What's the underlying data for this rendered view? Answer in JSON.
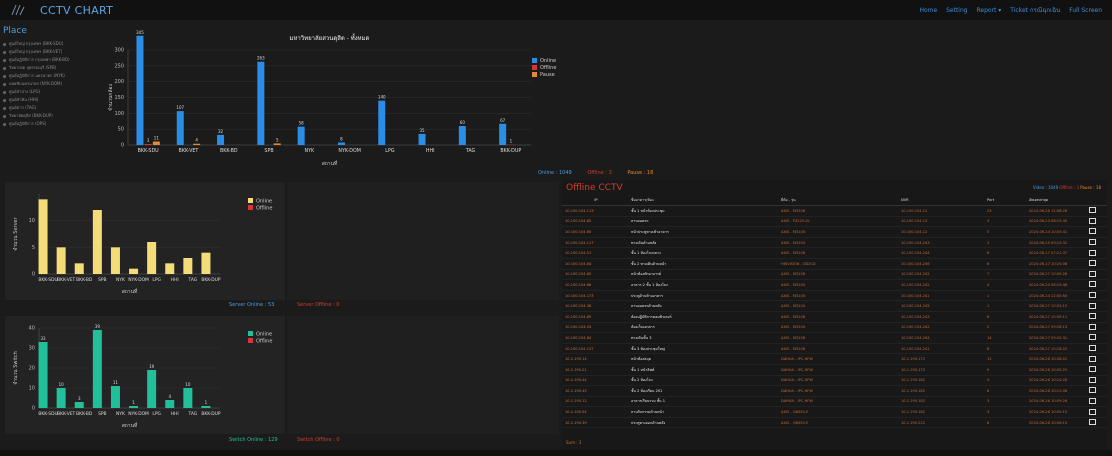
{
  "app": {
    "title": "CCTV CHART"
  },
  "nav": [
    "Home",
    "Setting",
    "Report",
    "Ticket กรณีฉุกเฉิน",
    "Full Screen"
  ],
  "place": {
    "title": "Place",
    "items": [
      "ศูนย์ใหญ่ กรุงเทพฯ (BKK-SDU)",
      "ศูนย์ใหญ่ กรุงเทพฯ (BKK-VET)",
      "ศูนย์ปฏิบัติการ กรุงเทพฯ (BKK-BD)",
      "วิทยาเขต สุพรรณบุรี (SPB)",
      "ศูนย์ปฏิบัติการ นครนายก (NYK)",
      "ดอยซับนครนายก (NYK-DOM)",
      "ศูนย์ลำปาง (LPG)",
      "ศูนย์หัวหิน (HHI)",
      "ศูนย์ตาก (TAG)",
      "วิทยาลัยดุสิต (BKK-DUP)",
      "ศูนย์ปฏิบัติการ (OPS)"
    ]
  },
  "colors": {
    "online": "#2b8ee6",
    "offline": "#d8323a",
    "pause": "#e58a2b",
    "yellow": "#f4dc78",
    "teal": "#22c09a"
  },
  "main_chart": {
    "type": "bar",
    "title": "มหาวิทยาลัยสวนดุสิต - ทั้งหมด",
    "ylabel": "จำนวนกล้อง",
    "xlabel": "สถานที่",
    "ylim": [
      0,
      300
    ],
    "yticks": [
      0,
      50,
      100,
      150,
      200,
      250,
      300
    ],
    "categories": [
      "BKK-SDU",
      "BKK-VET",
      "BKK-BD",
      "SPB",
      "NYK",
      "NYK-DOM",
      "LPG",
      "HHI",
      "TAG",
      "BKK-DUP"
    ],
    "series": [
      {
        "name": "Online",
        "values": [
          345,
          107,
          32,
          263,
          58,
          8,
          140,
          35,
          60,
          67
        ]
      },
      {
        "name": "Offline",
        "values": [
          3,
          0,
          0,
          0,
          0,
          0,
          0,
          0,
          0,
          1
        ]
      },
      {
        "name": "Pause",
        "values": [
          11,
          4,
          0,
          5,
          0,
          0,
          0,
          0,
          0,
          0
        ]
      }
    ],
    "legend": [
      "Online",
      "Offline",
      "Pause"
    ]
  },
  "stats": {
    "online": "Online : 1049",
    "offline": "Offline : 3",
    "pause": "Pause : 18"
  },
  "server_chart": {
    "type": "bar",
    "ylabel": "จำนวน Server",
    "xlabel": "สถานที่",
    "ylim": [
      0,
      15
    ],
    "yticks": [
      0,
      5,
      10
    ],
    "categories": [
      "BKK-SDU",
      "BKK-VET",
      "BKK-BD",
      "SPB",
      "NYK",
      "NYK-DOM",
      "LPG",
      "HHI",
      "TAG",
      "BKK-DUP"
    ],
    "series": [
      {
        "name": "Online",
        "values": [
          14,
          5,
          2,
          12,
          5,
          1,
          6,
          2,
          3,
          4
        ]
      },
      {
        "name": "Offline",
        "values": [
          0,
          0,
          0,
          0,
          0,
          0,
          0,
          0,
          0,
          0
        ]
      }
    ],
    "legend": [
      "Online",
      "Offline"
    ],
    "footer_online": "Server Online : 53",
    "footer_offline": "Server Offline : 0"
  },
  "switch_chart": {
    "type": "bar",
    "ylabel": "จำนวน Switch",
    "xlabel": "สถานที่",
    "ylim": [
      0,
      40
    ],
    "yticks": [
      0,
      10,
      20,
      30,
      40
    ],
    "categories": [
      "BKK-SDU",
      "BKK-VET",
      "BKK-BD",
      "SPB",
      "NYK",
      "NYK-DOM",
      "LPG",
      "HHI",
      "TAG",
      "BKK-DUP"
    ],
    "series": [
      {
        "name": "Online",
        "values": [
          33,
          10,
          3,
          39,
          11,
          1,
          19,
          4,
          10,
          1
        ]
      },
      {
        "name": "Offline",
        "values": [
          0,
          0,
          0,
          0,
          0,
          0,
          0,
          0,
          0,
          0
        ]
      }
    ],
    "legend": [
      "Online",
      "Offline"
    ],
    "footer_online": "Switch Online : 129",
    "footer_offline": "Switch Offline : 0"
  },
  "offline_cctv": {
    "title": "Offline CCTV",
    "stats": {
      "video": "Video : 1049",
      "offline": "Offline : 3",
      "pause": "Pause : 18"
    },
    "headers": [
      "IP",
      "ชื่ออาคาร/ห้อง",
      "ยี่ห้อ - รุ่น",
      "NVR",
      "Port",
      "อัพเดทล่าสุด",
      ""
    ],
    "rows": [
      [
        "10.100.104.113",
        "ชั้น 1 หน้าห้องประชุม",
        "AXIS - M3106",
        "10.100.104.12",
        "23",
        "2024-06-26 12:08:28"
      ],
      [
        "10.100.104.62",
        "ลานจอดรถ",
        "AXIS - P3225-LV",
        "10.100.104.13",
        "3",
        "2024-06-23 08:25:40"
      ],
      [
        "10.100.104.60",
        "หน้าประตูทางเข้าอาคาร",
        "AXIS - M3104",
        "10.100.104.12",
        "5",
        "2024-06-24 10:05:41"
      ],
      [
        "10.100.104.117",
        "ทางเดินด้านหลัง",
        "AXIS - M3104",
        "10.100.104.243",
        "3",
        "2024-06-25 09:15:32"
      ],
      [
        "10.100.104.51",
        "ชั้น 1 ห้องโถงกลาง",
        "AXIS - M3106",
        "10.100.104.244",
        "6",
        "2024-06-17 07:21:37"
      ],
      [
        "10.100.104.64",
        "ชั้น 2 ทางเดินด้านหน้า",
        "HIKVISION - DS2CD",
        "10.100.104.246",
        "6",
        "2024-06-17 10:25:08"
      ],
      [
        "10.100.104.65",
        "หน้าห้องพักอาจารย์",
        "AXIS - M3106",
        "10.100.104.242",
        "7",
        "2024-06-27 10:09:28"
      ],
      [
        "10.100.104.66",
        "อาคาร 2 ชั้น 1 ห้องโถง",
        "AXIS - M3104",
        "10.100.104.242",
        "4",
        "2024-06-20 08:10:46"
      ],
      [
        "10.100.104.173",
        "ประตูด้านข้างอาคาร",
        "AXIS - M3104",
        "10.100.104.241",
        "1",
        "2024-06-24 12:00:50"
      ],
      [
        "10.100.104.36",
        "ลานจอดรถด้านหลัง",
        "AXIS - M3104",
        "10.100.104.245",
        "1",
        "2024-06-27 10:03:15"
      ],
      [
        "10.100.104.69",
        "ห้องปฏิบัติการคอมพิวเตอร์",
        "AXIS - M3106",
        "10.100.104.243",
        "6",
        "2024-06-27 10:09:11"
      ],
      [
        "10.100.104.53",
        "ห้องเก็บเอกสาร",
        "AXIS - M3104",
        "10.100.104.242",
        "2",
        "2024-06-27 09:26:13"
      ],
      [
        "10.100.104.64",
        "ทางเดินชั้น 3",
        "AXIS - M3106",
        "10.100.104.244",
        "14",
        "2024-06-27 09:20:31"
      ],
      [
        "10.100.104.137",
        "ชั้น 3 ห้องประชุมใหญ่",
        "AXIS - M3106",
        "10.100.104.241",
        "8",
        "2024-06-27 10:18:22"
      ],
      [
        "10.1.190.14",
        "หน้าห้องสมุด",
        "DAHUA - IPC-HFW",
        "10.1.190.172",
        "12",
        "2024-06-26 10:28:01"
      ],
      [
        "10.1.190.21",
        "ชั้น 1 หน้าลิฟต์",
        "DAHUA - IPC-HFW",
        "10.1.190.172",
        "9",
        "2024-06-26 10:05:25"
      ],
      [
        "10.1.190.44",
        "ชั้น 2 ห้องโถง",
        "DAHUA - IPC-HFW",
        "10.1.190.182",
        "4",
        "2024-06-26 10:14:28"
      ],
      [
        "10.1.190.45",
        "ชั้น 2 ห้องเรียน 201",
        "DAHUA - IPC-HFW",
        "10.1.190.182",
        "6",
        "2024-06-26 10:12:08"
      ],
      [
        "10.1.190.12",
        "อาคารเรียนรวม ชั้น 1",
        "DAHUA - IPC-HFW",
        "10.1.190.182",
        "3",
        "2024-06-26 10:09:28"
      ],
      [
        "10.1.190.54",
        "ลานกิจกรรมด้านหน้า",
        "AXIS - Q6055-E",
        "10.1.190.182",
        "3",
        "2024-06-26 10:00:15"
      ],
      [
        "10.1.190.39",
        "ประตูทางออกด้านหลัง",
        "AXIS - Q6055-E",
        "10.1.190.222",
        "6",
        "2024-06-26 10:06:15"
      ]
    ],
    "sum": "Sum : 3"
  }
}
